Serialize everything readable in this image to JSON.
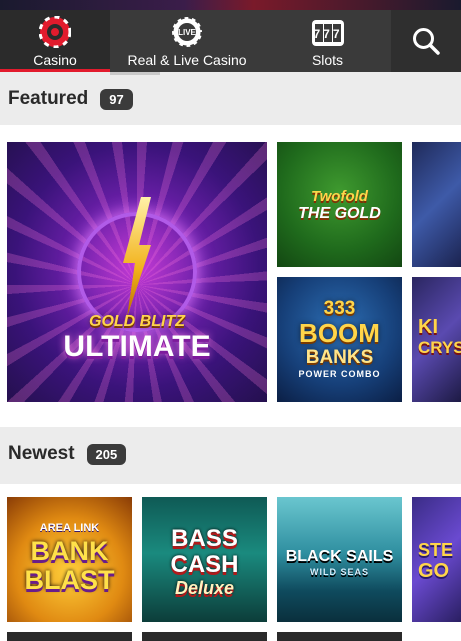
{
  "nav": {
    "tabs": [
      {
        "label": "Casino",
        "icon": "casino-chip-icon",
        "active": true
      },
      {
        "label": "Real & Live Casino",
        "icon": "live-chip-icon",
        "active": false
      },
      {
        "label": "Slots",
        "icon": "slot-machine-icon",
        "active": false
      }
    ],
    "search_icon": "search-icon",
    "live_badge": "LIVE",
    "slots_reels": "777"
  },
  "featured": {
    "title": "Featured",
    "count": "97",
    "games": [
      {
        "name": "Gold Blitz Ultimate",
        "art_sub": "GOLD BLITZ",
        "art_main": "ULTIMATE"
      },
      {
        "name": "Twofold The Gold",
        "art_line1": "Twofold",
        "art_line2": "THE GOLD"
      },
      {
        "name": "333 Boom Banks Power Combo",
        "art_line1": "333",
        "art_line2": "BOOM",
        "art_line3": "BANKS",
        "art_line4": "POWER COMBO"
      },
      {
        "name": "partially visible game",
        "art_line1": "KI",
        "art_line2": "CRYS"
      }
    ]
  },
  "newest": {
    "title": "Newest",
    "count": "205",
    "games": [
      {
        "name": "Area Link Bank Blast",
        "art_pre": "AREA LINK",
        "art_line1": "BANK",
        "art_line2": "BLAST"
      },
      {
        "name": "Bass Cash Deluxe",
        "art_line1": "BASS",
        "art_line2": "CASH",
        "art_line3": "Deluxe"
      },
      {
        "name": "Black Sails Wild Seas",
        "art_line1": "BLACK SAILS",
        "art_line2": "WILD SEAS"
      },
      {
        "name": "partially visible game",
        "art_line1": "STE",
        "art_line2": "GO"
      }
    ]
  },
  "colors": {
    "accent": "#e21b2d",
    "nav_bg": "#3a3a3a",
    "badge_bg": "#3b3b3b",
    "page_bg": "#ececec"
  }
}
